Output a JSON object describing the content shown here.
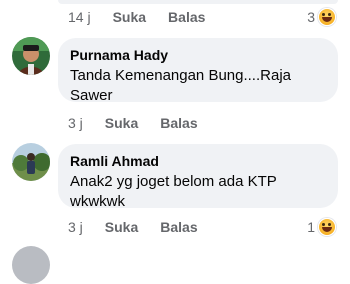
{
  "comments": [
    {
      "time": "14 j",
      "like_label": "Suka",
      "reply_label": "Balas",
      "reaction_count": "3",
      "reaction_icon": "haha-emoji-icon"
    },
    {
      "name": "Purnama Hady",
      "text_line1": "Tanda Kemenangan Bung....Raja",
      "text_line2": "Sawer",
      "time": "3 j",
      "like_label": "Suka",
      "reply_label": "Balas"
    },
    {
      "name": "Ramli Ahmad",
      "text_line1": "Anak2 yg joget belom ada KTP",
      "text_line2": "wkwkwk",
      "time": "3 j",
      "like_label": "Suka",
      "reply_label": "Balas",
      "reaction_count": "1",
      "reaction_icon": "haha-emoji-icon"
    }
  ],
  "colors": {
    "bubble_bg": "#f0f2f5",
    "meta_text": "#65676b",
    "primary_text": "#050505"
  }
}
